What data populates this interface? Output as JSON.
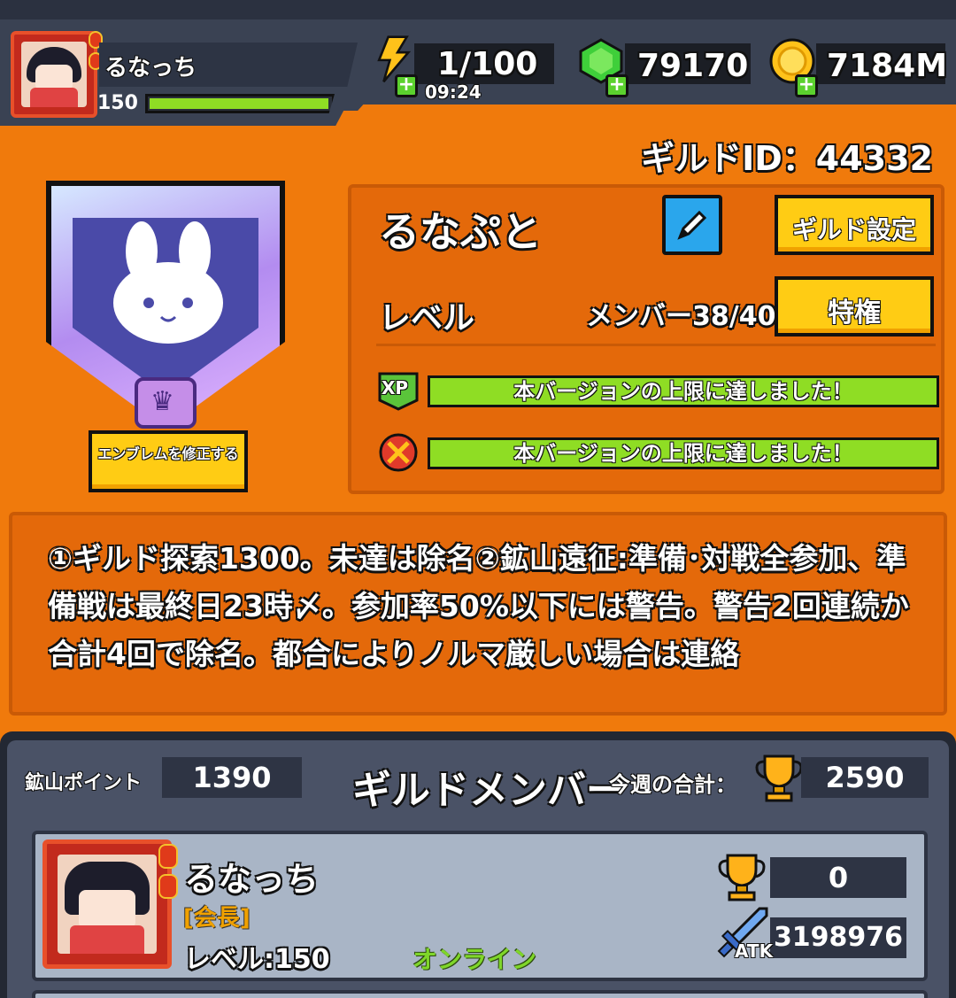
{
  "player": {
    "name": "るなっち",
    "level": "150",
    "xp_fraction": 0.97
  },
  "resources": {
    "energy": "1/100",
    "energy_timer": "09:24",
    "gems": "79170",
    "gold": "7184M"
  },
  "guild": {
    "id_text": "ギルドID：44332",
    "name": "るなぷと",
    "settings_label": "ギルド設定",
    "level_label": "レベル",
    "members_text": "メンバー38/40",
    "privilege_label": "特権",
    "emblem_button": "エンブレムを修正する",
    "xp_icon": "XP",
    "progress_xp_text": "本バージョンの上限に達しました！",
    "progress_mine_text": "本バージョンの上限に達しました！",
    "description": "①ギルド探索1300。未達は除名②鉱山遠征:準備･対戦全参加、準備戦は最終日23時〆。参加率50%以下には警告。警告2回連続か合計4回で除名。都合によりノルマ厳しい場合は連絡"
  },
  "members_section": {
    "mine_points_label": "鉱山ポイント",
    "mine_points": "1390",
    "title": "ギルドメンバー",
    "weekly_total_label": "今週の合計：",
    "weekly_total": "2590"
  },
  "member_list": [
    {
      "name": "るなっち",
      "role": "[会長]",
      "level": "レベル:150",
      "status": "オンライン",
      "score": "0",
      "atk_label": "ATK",
      "atk": "3198976"
    }
  ],
  "colors": {
    "background_orange": "#f07a0c",
    "panel_orange": "#e4690a",
    "top_bar": "#3a4253",
    "progress_green": "#8fdd24",
    "button_yellow": "#ffcc14",
    "edit_blue": "#2aa6ec",
    "member_card": "#a9b5c6"
  },
  "icons": {
    "energy": "lightning-bolt-icon",
    "gems": "green-gem-icon",
    "gold": "gold-coin-icon",
    "edit": "pencil-icon",
    "emblem": "rabbit-emblem-icon",
    "trophy": "trophy-icon",
    "atk": "sword-icon",
    "mine": "pickaxe-icon"
  }
}
